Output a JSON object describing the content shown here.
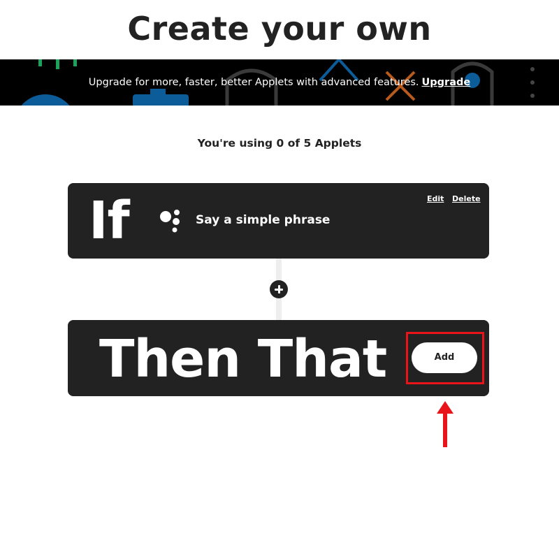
{
  "page": {
    "title": "Create your own",
    "usage_text": "You're using 0 of 5 Applets"
  },
  "banner": {
    "message": "Upgrade for more, faster, better Applets with advanced features.",
    "link_label": "Upgrade"
  },
  "if_card": {
    "label": "If",
    "trigger_label": "Say a simple phrase",
    "trigger_icon": "google-assistant-icon",
    "edit_label": "Edit",
    "delete_label": "Delete"
  },
  "then_card": {
    "label": "Then That",
    "add_label": "Add"
  },
  "colors": {
    "card_background": "#222222",
    "banner_background": "#000000",
    "annotation_red": "#e8141a"
  }
}
